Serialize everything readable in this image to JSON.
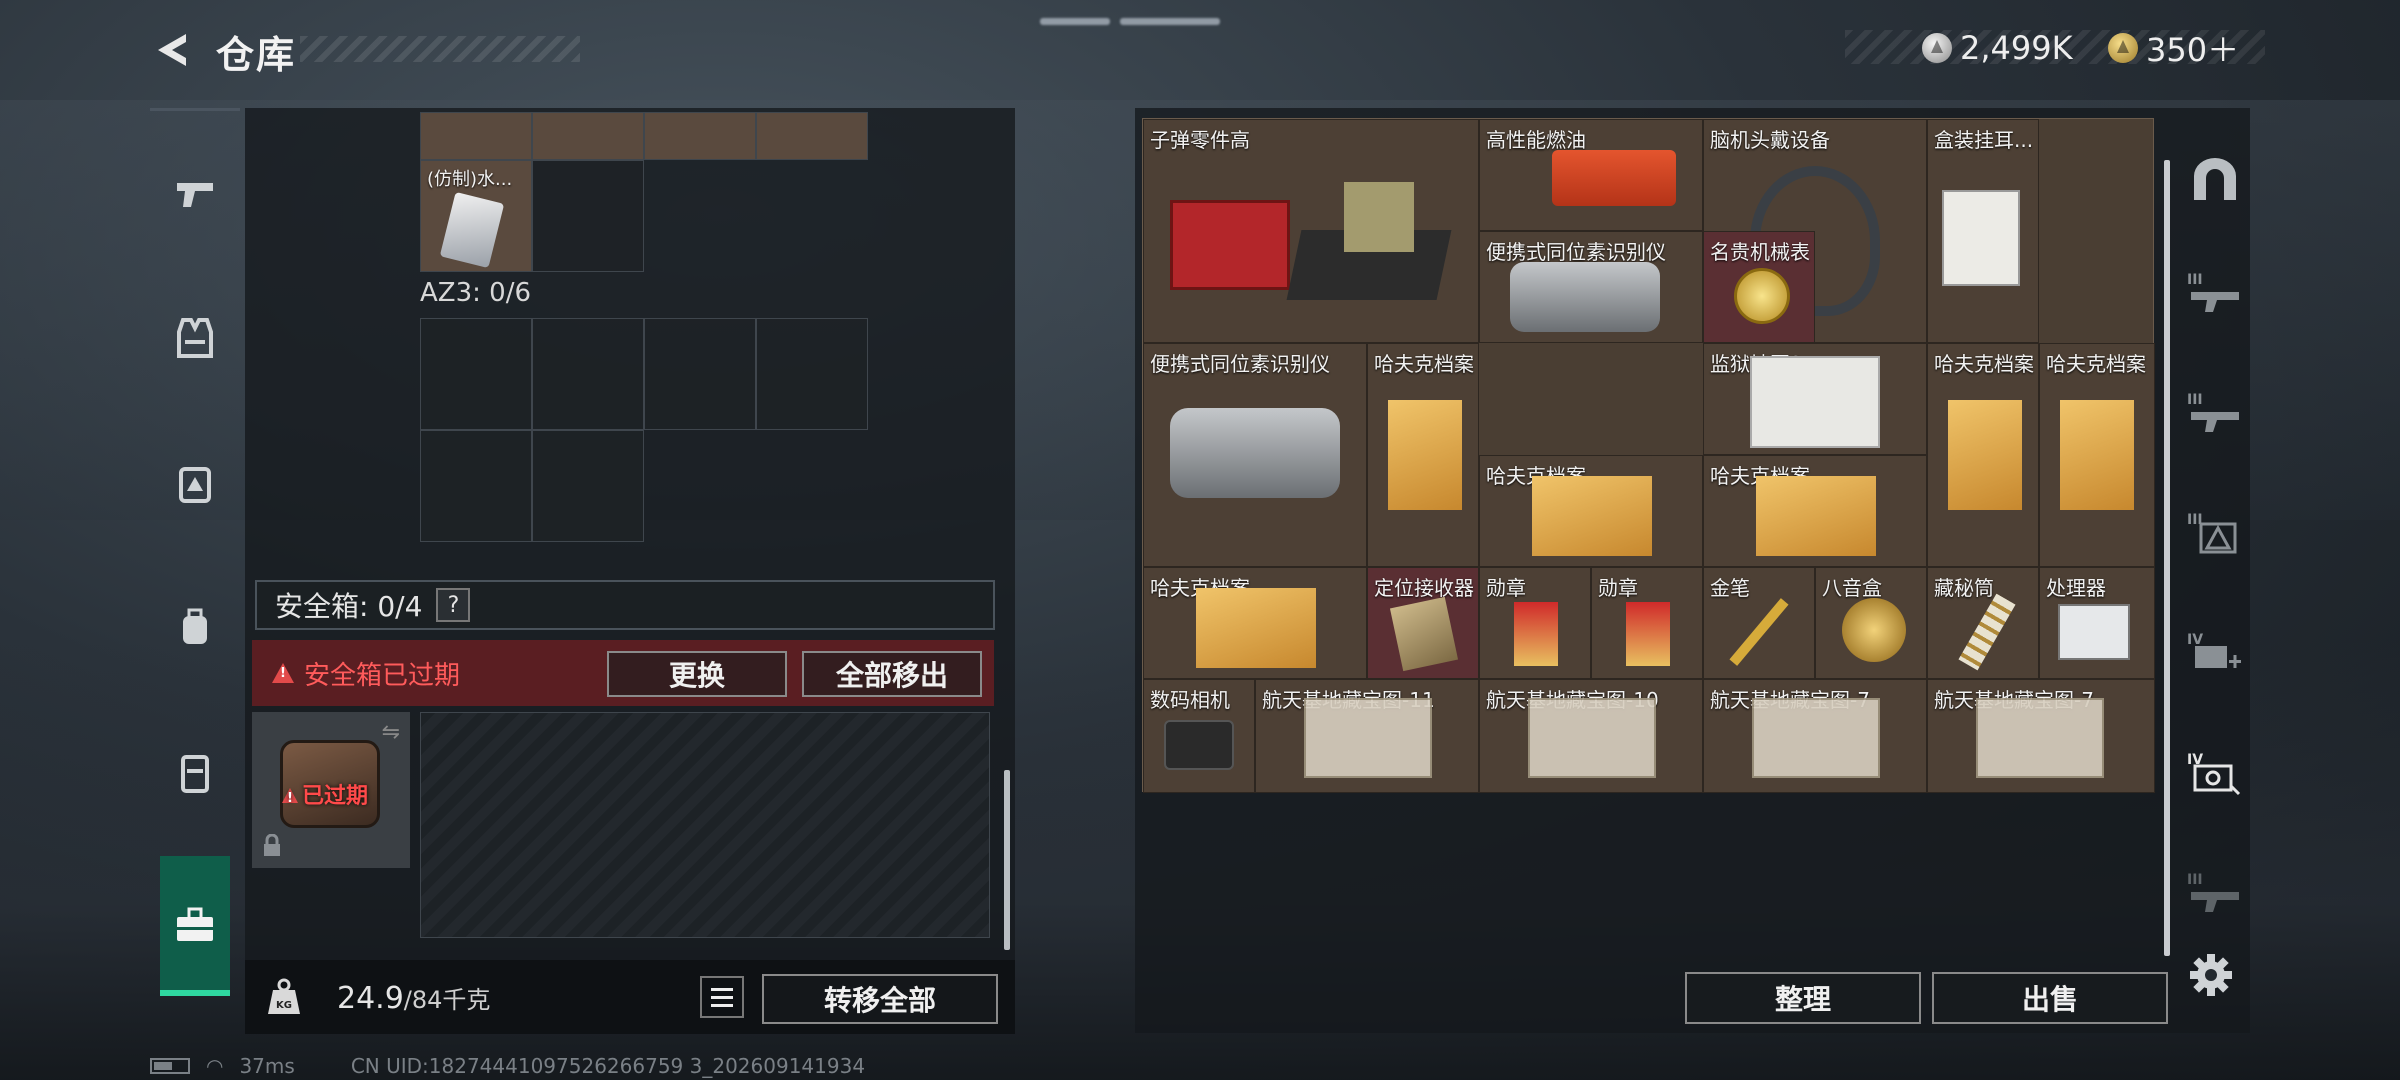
{
  "header": {
    "title": "仓库",
    "currency_silver": "2,499K",
    "currency_gold": "350＋"
  },
  "left_panel": {
    "top_item_label": "(仿制)水...",
    "container_label": "AZ3: 0/6",
    "safe_box_label": "安全箱: 0/4",
    "help_label": "?",
    "expired_notice": "安全箱已过期",
    "replace_button": "更换",
    "remove_all_button": "全部移出",
    "case_status": "已过期",
    "weight_current": "24.9",
    "weight_capacity": "/84千克",
    "kg_label": "KG",
    "transfer_all_button": "转移全部"
  },
  "stash": {
    "items": [
      {
        "label": "子弹零件高"
      },
      {
        "label": "高性能燃油"
      },
      {
        "label": "脑机头戴设备"
      },
      {
        "label": "盒装挂耳..."
      },
      {
        "label": "便携式同位素识别仪"
      },
      {
        "label": "名贵机械表"
      },
      {
        "label": "便携式同位素识别仪"
      },
      {
        "label": "哈夫克档案"
      },
      {
        "label": "监狱地图2"
      },
      {
        "label": "哈夫克档案"
      },
      {
        "label": "哈夫克档案"
      },
      {
        "label": "哈夫克档案"
      },
      {
        "label": "哈夫克档案"
      },
      {
        "label": "哈夫克档案"
      },
      {
        "label": "定位接收器"
      },
      {
        "label": "勋章"
      },
      {
        "label": "勋章"
      },
      {
        "label": "金笔"
      },
      {
        "label": "八音盒"
      },
      {
        "label": "藏秘筒"
      },
      {
        "label": "处理器"
      },
      {
        "label": "数码相机"
      },
      {
        "label": "航天基地藏宝图-11"
      },
      {
        "label": "航天基地藏宝图-10"
      },
      {
        "label": "航天基地藏宝图-7"
      },
      {
        "label": "航天基地藏宝图-7"
      }
    ],
    "sort_button": "整理",
    "sell_button": "出售"
  },
  "side_tabs": [
    "III",
    "III",
    "III",
    "IV",
    "IV",
    "III"
  ],
  "status_bar": {
    "ping": "37ms",
    "uid": "CN UID:18274441097526266759 3_202609141934"
  },
  "colors": {
    "accent_green": "#2fd7a0",
    "warning_red": "#ff5b5b",
    "stash_bg": "#4a3e33"
  }
}
